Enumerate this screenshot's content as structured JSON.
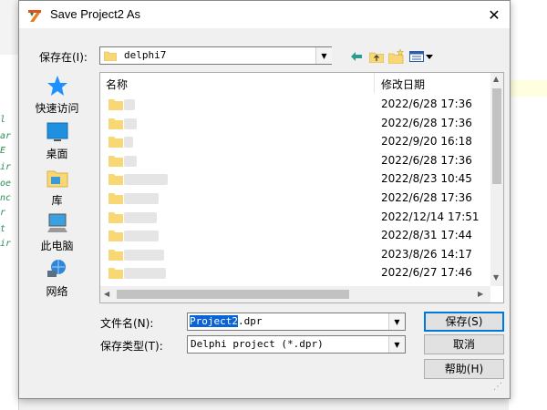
{
  "window": {
    "title": "Save Project2 As",
    "close_glyph": "✕"
  },
  "toolbar": {
    "save_in_label": "保存在(I):",
    "save_in_value": "delphi7",
    "back_icon": "back-arrow-icon",
    "up_icon": "up-folder-icon",
    "new_folder_icon": "new-folder-icon",
    "view_menu_icon": "view-menu-icon"
  },
  "places": [
    {
      "label": "快速访问",
      "icon": "star-icon"
    },
    {
      "label": "桌面",
      "icon": "desktop-icon"
    },
    {
      "label": "库",
      "icon": "library-icon"
    },
    {
      "label": "此电脑",
      "icon": "computer-icon"
    },
    {
      "label": "网络",
      "icon": "network-icon"
    }
  ],
  "file_list": {
    "columns": {
      "name": "名称",
      "date": "修改日期"
    },
    "rows": [
      {
        "date": "2022/6/28 17:36"
      },
      {
        "date": "2022/6/28 17:36"
      },
      {
        "date": "2022/9/20 16:18"
      },
      {
        "date": "2022/6/28 17:36"
      },
      {
        "date": "2022/8/23 10:45"
      },
      {
        "date": "2022/6/28 17:36"
      },
      {
        "date": "2022/12/14 17:51"
      },
      {
        "date": "2022/8/31 17:44"
      },
      {
        "date": "2023/8/26 14:17"
      },
      {
        "date": "2022/6/27 17:46"
      }
    ]
  },
  "file_name": {
    "label": "文件名(N):",
    "selected_part": "Project2",
    "rest": ".dpr"
  },
  "file_type": {
    "label": "保存类型(T):",
    "value": "Delphi project (*.dpr)"
  },
  "buttons": {
    "save": "保存(S)",
    "cancel": "取消",
    "help": "帮助(H)"
  },
  "colors": {
    "folder": "#f8d775",
    "selection": "#0a64d8",
    "accent": "#0078d7"
  }
}
